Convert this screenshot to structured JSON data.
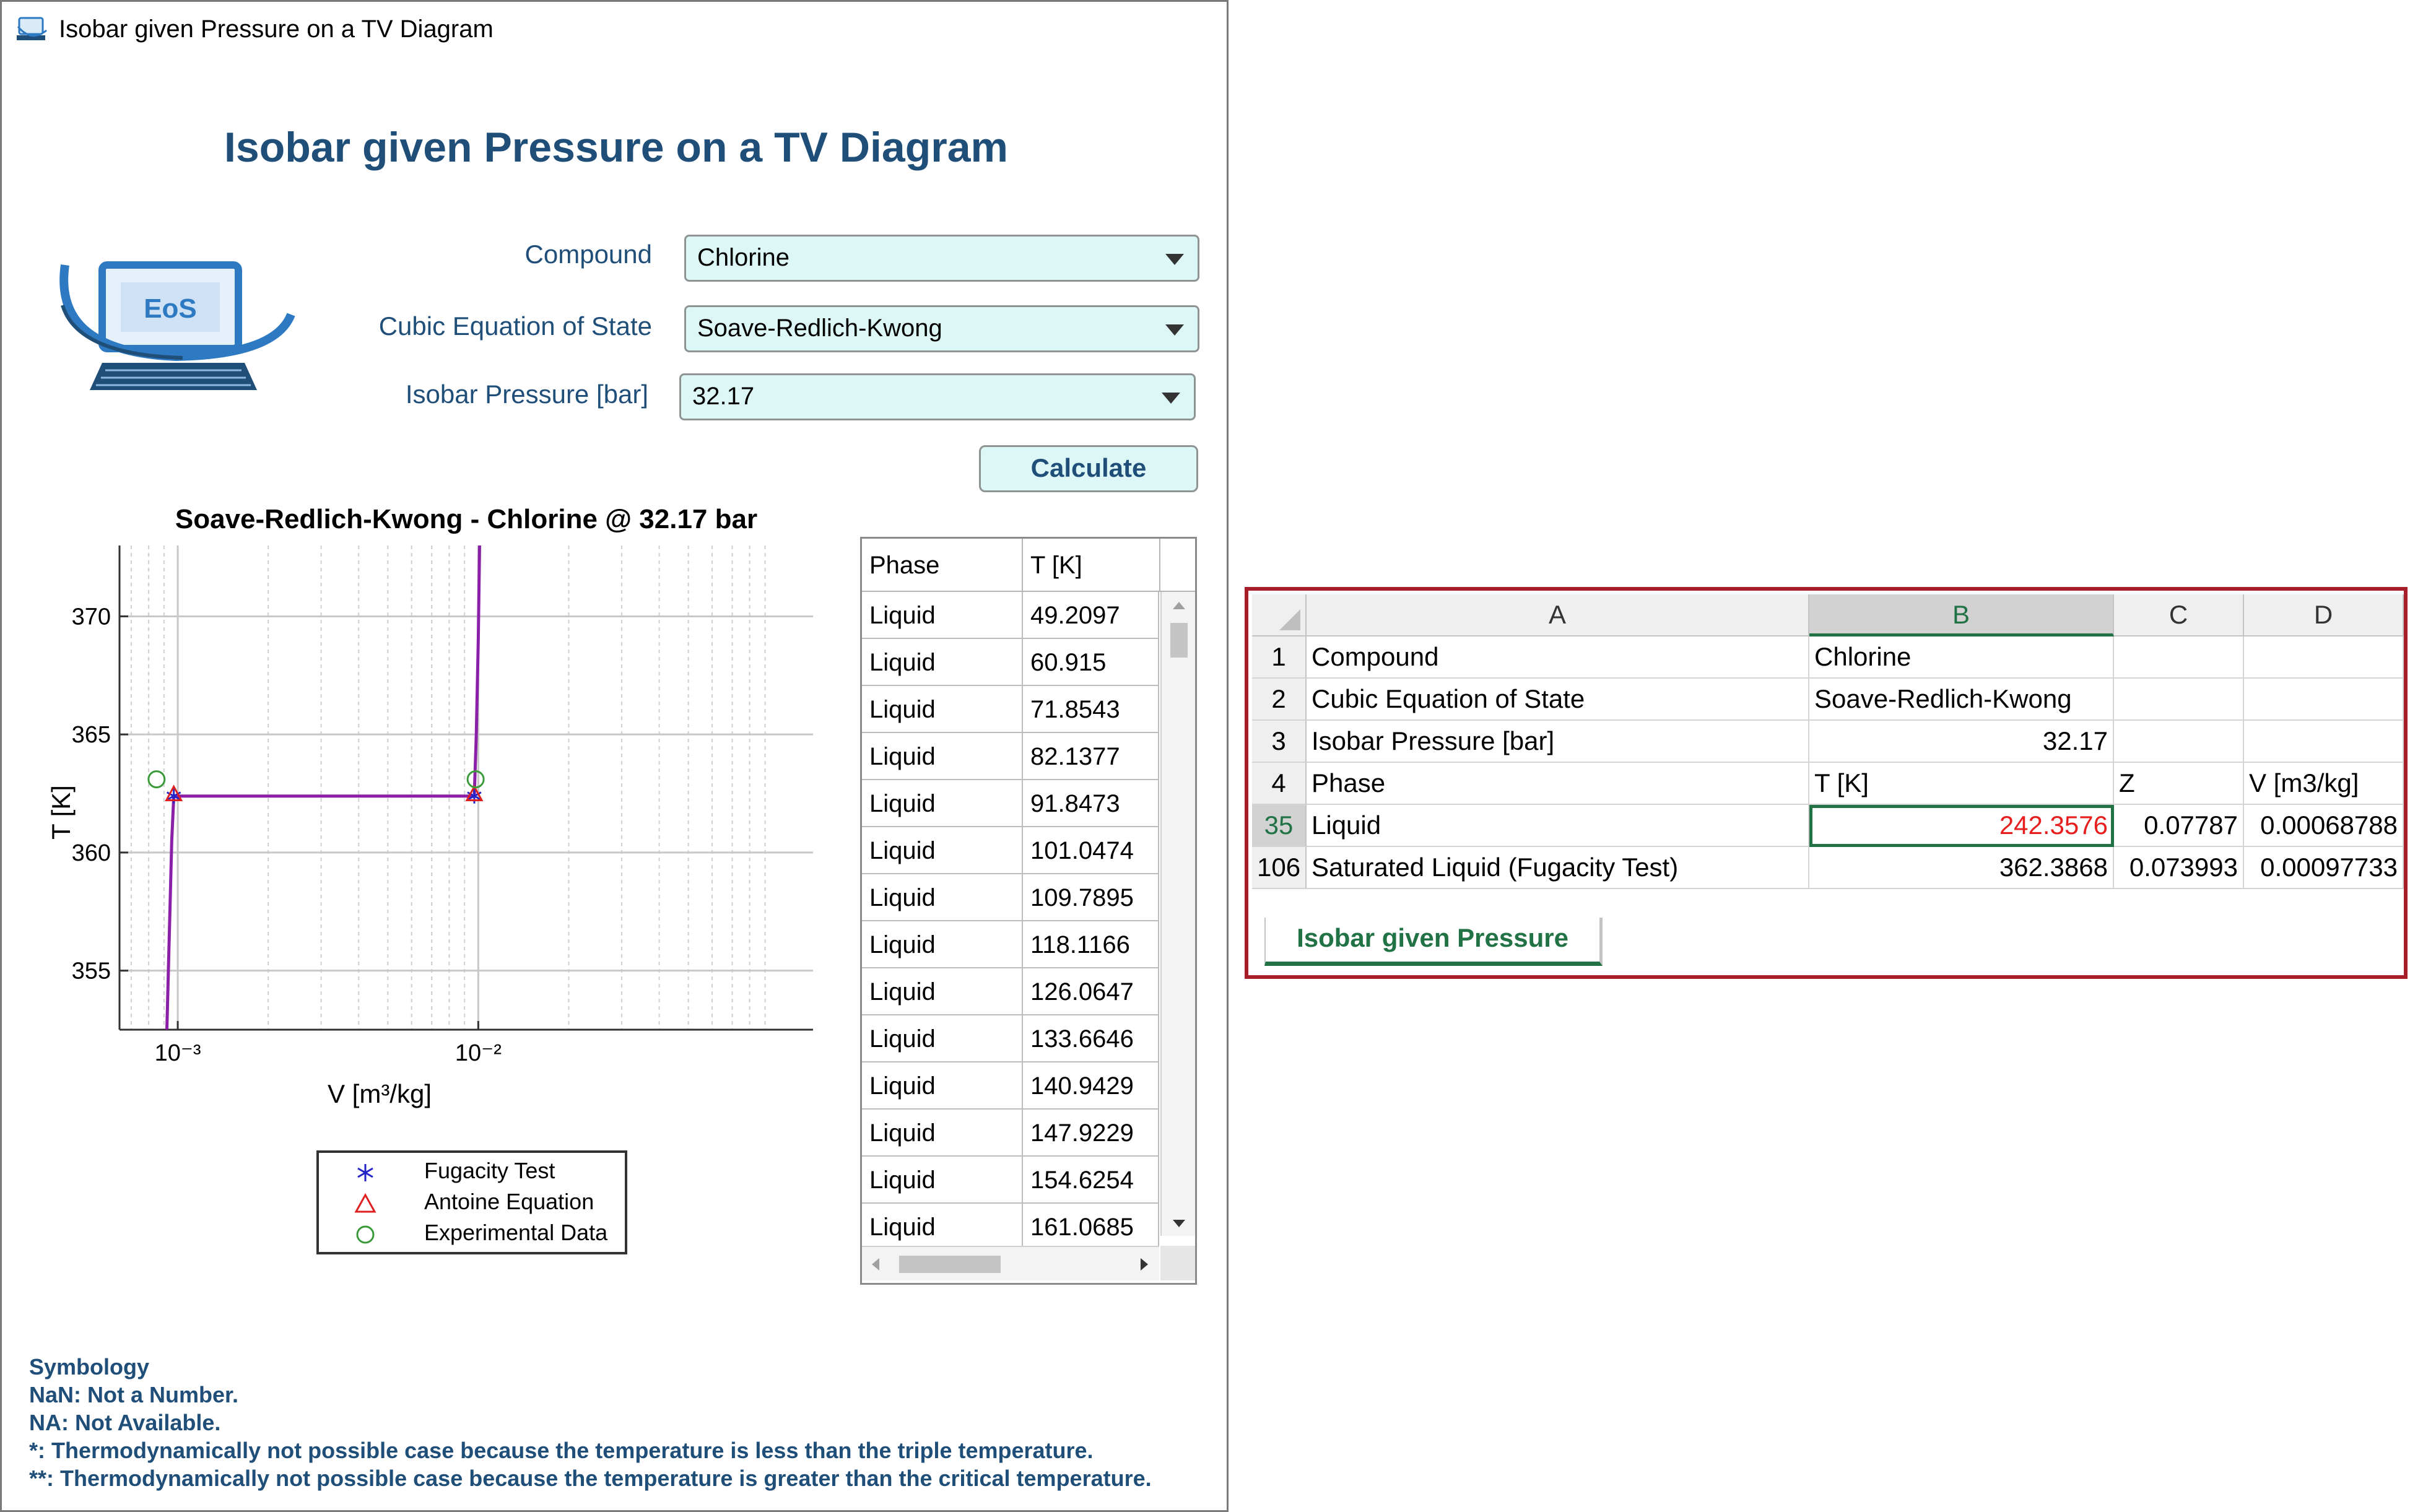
{
  "app": {
    "window_title": "Isobar given Pressure on a TV Diagram",
    "main_title": "Isobar given Pressure on a TV Diagram",
    "logo_text": "EoS",
    "form": {
      "compound_label": "Compound",
      "compound_value": "Chlorine",
      "eos_label": "Cubic Equation of State",
      "eos_value": "Soave-Redlich-Kwong",
      "pressure_label": "Isobar Pressure [bar]",
      "pressure_value": "32.17",
      "calculate_label": "Calculate"
    },
    "legend": [
      "Fugacity Test",
      "Antoine Equation",
      "Experimental Data"
    ],
    "table": {
      "headers": [
        "Phase",
        "T [K]"
      ],
      "rows": [
        [
          "Liquid",
          "49.2097"
        ],
        [
          "Liquid",
          "60.915"
        ],
        [
          "Liquid",
          "71.8543"
        ],
        [
          "Liquid",
          "82.1377"
        ],
        [
          "Liquid",
          "91.8473"
        ],
        [
          "Liquid",
          "101.0474"
        ],
        [
          "Liquid",
          "109.7895"
        ],
        [
          "Liquid",
          "118.1166"
        ],
        [
          "Liquid",
          "126.0647"
        ],
        [
          "Liquid",
          "133.6646"
        ],
        [
          "Liquid",
          "140.9429"
        ],
        [
          "Liquid",
          "147.9229"
        ],
        [
          "Liquid",
          "154.6254"
        ],
        [
          "Liquid",
          "161.0685"
        ]
      ]
    },
    "symbology": {
      "title": "Symbology",
      "lines": [
        "NaN: Not a Number.",
        "NA: Not Available.",
        "*: Thermodynamically not possible case because the temperature is less than the triple temperature.",
        "**: Thermodynamically not possible case because the temperature is greater than the critical temperature."
      ]
    }
  },
  "chart_data": {
    "type": "line",
    "title": "Soave-Redlich-Kwong - Chlorine @ 32.17 bar",
    "xlabel": "V  [m³/kg]",
    "ylabel": "T [K]",
    "xscale": "log",
    "xlim": [
      0.00064,
      0.13
    ],
    "ylim": [
      352.5,
      373
    ],
    "xticks": [
      {
        "value": 0.001,
        "label": "10⁻³"
      },
      {
        "value": 0.01,
        "label": "10⁻²"
      }
    ],
    "yticks": [
      355,
      360,
      365,
      370
    ],
    "grid": true,
    "legend_position": "below",
    "series": [
      {
        "name": "",
        "kind": "isobar",
        "color": "#8b1fa8",
        "x": [
          0.00092,
          0.000935,
          0.000955,
          0.00097,
          0.0081,
          0.0097,
          0.00985,
          0.01,
          0.0101
        ],
        "y": [
          352.5,
          356.0,
          360.5,
          362.39,
          362.39,
          362.39,
          365.0,
          369.0,
          373.0
        ]
      },
      {
        "name": "Fugacity Test",
        "marker": "asterisk",
        "color": "#2424c8",
        "x": [
          0.00097,
          0.0097
        ],
        "y": [
          362.39,
          362.39
        ]
      },
      {
        "name": "Antoine Equation",
        "marker": "triangle",
        "color": "#e02020",
        "x": [
          0.00097,
          0.0097
        ],
        "y": [
          362.45,
          362.45
        ]
      },
      {
        "name": "Experimental Data",
        "marker": "circle",
        "color": "#3a9a3a",
        "x": [
          0.00085,
          0.0098
        ],
        "y": [
          363.1,
          363.1
        ]
      }
    ]
  },
  "excel": {
    "columns": [
      "A",
      "B",
      "C",
      "D"
    ],
    "rows": [
      {
        "num": "1",
        "a": "Compound",
        "b": "Chlorine",
        "c": "",
        "d": ""
      },
      {
        "num": "2",
        "a": "Cubic Equation of State",
        "b": "Soave-Redlich-Kwong",
        "c": "",
        "d": ""
      },
      {
        "num": "3",
        "a": "Isobar Pressure [bar]",
        "b": "32.17",
        "c": "",
        "d": ""
      },
      {
        "num": "4",
        "a": "Phase",
        "b": "T [K]",
        "c": "Z",
        "d": "V [m3/kg]"
      },
      {
        "num": "35",
        "a": "Liquid",
        "b": "242.3576",
        "c": "0.07787",
        "d": "0.00068788"
      },
      {
        "num": "106",
        "a": "Saturated Liquid (Fugacity Test)",
        "b": "362.3868",
        "c": "0.073993",
        "d": "0.00097733"
      }
    ],
    "sheet_tab": "Isobar given Pressure",
    "colors": {
      "selected_value": "#e81e1e",
      "accent": "#217346"
    }
  }
}
